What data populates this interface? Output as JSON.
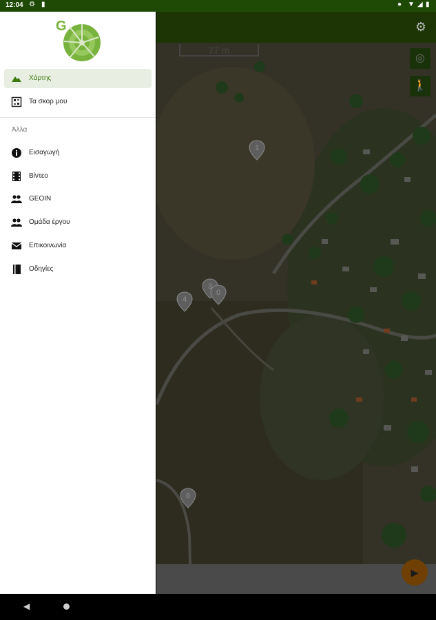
{
  "status_bar": {
    "time": "12:04",
    "icons": [
      "settings-icon",
      "sd-card-icon",
      "location-icon",
      "wifi-icon",
      "signal-icon",
      "battery-icon"
    ]
  },
  "drawer": {
    "items": [
      {
        "label": "Χάρτης",
        "icon": "terrain-icon",
        "active": true
      },
      {
        "label": "Τα σκορ μου",
        "icon": "score-icon",
        "active": false
      }
    ],
    "section_label": "Άλλα",
    "other_items": [
      {
        "label": "Εισαγωγή",
        "icon": "info-icon"
      },
      {
        "label": "Βίντεο",
        "icon": "film-icon"
      },
      {
        "label": "GEOIN",
        "icon": "people-icon"
      },
      {
        "label": "Ομάδα έργου",
        "icon": "people-icon"
      },
      {
        "label": "Επικοινωνία",
        "icon": "mail-icon"
      },
      {
        "label": "Οδηγίες",
        "icon": "book-icon"
      }
    ]
  },
  "map": {
    "scale_label": "77 m",
    "markers": [
      "1",
      "3",
      "4",
      "0",
      "6"
    ]
  },
  "colors": {
    "status_bar": "#1e4a06",
    "toolbar": "#1d3504",
    "accent": "#3c7a10",
    "fab": "#6f3f03"
  }
}
